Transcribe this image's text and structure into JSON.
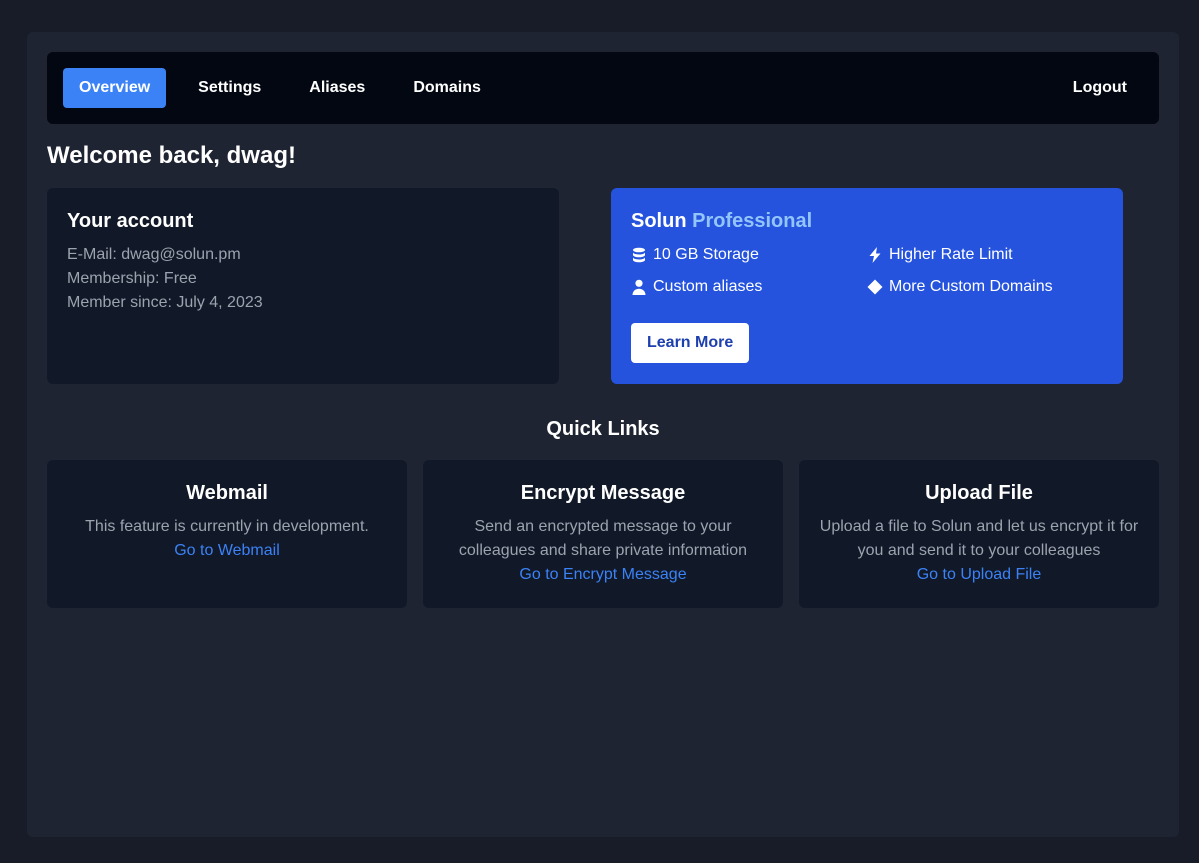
{
  "nav": {
    "items": [
      {
        "label": "Overview",
        "active": true
      },
      {
        "label": "Settings"
      },
      {
        "label": "Aliases"
      },
      {
        "label": "Domains"
      }
    ],
    "logout": "Logout"
  },
  "welcome": "Welcome back, dwag!",
  "account": {
    "title": "Your account",
    "email": "E-Mail: dwag@solun.pm",
    "membership": "Membership: Free",
    "member_since": "Member since: July 4, 2023"
  },
  "pro": {
    "title_prefix": "Solun",
    "title_highlight": "Professional",
    "features": [
      {
        "icon": "database-icon",
        "label": "10 GB Storage"
      },
      {
        "icon": "bolt-icon",
        "label": "Higher Rate Limit"
      },
      {
        "icon": "user-icon",
        "label": "Custom aliases"
      },
      {
        "icon": "diamond-icon",
        "label": "More Custom Domains"
      }
    ],
    "button": "Learn More"
  },
  "quick_links": {
    "title": "Quick Links",
    "cards": [
      {
        "title": "Webmail",
        "desc": "This feature is currently in development.",
        "link": "Go to Webmail"
      },
      {
        "title": "Encrypt Message",
        "desc": "Send an encrypted message to your colleagues and share private information",
        "link": "Go to Encrypt Message"
      },
      {
        "title": "Upload File",
        "desc": "Upload a file to Solun and let us encrypt it for you and send it to your colleagues",
        "link": "Go to Upload File"
      }
    ]
  },
  "colors": {
    "accent": "#3b82f6",
    "pro_bg": "#2553dd",
    "card_bg": "#111827",
    "nav_bg": "#030712"
  }
}
